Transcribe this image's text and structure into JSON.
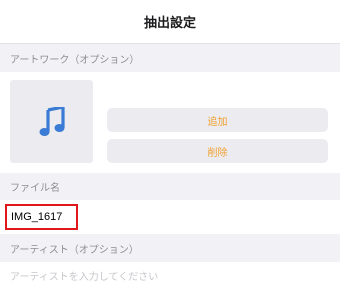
{
  "header": {
    "title": "抽出設定"
  },
  "artwork": {
    "section_label": "アートワーク（オプション）",
    "icon": "music-note-icon",
    "add_label": "追加",
    "delete_label": "削除"
  },
  "filename": {
    "section_label": "ファイル名",
    "value": "IMG_1617"
  },
  "artist": {
    "section_label": "アーティスト（オプション）",
    "placeholder": "アーティストを入力してください"
  },
  "colors": {
    "accent": "#f0a030",
    "music_icon": "#3a7bd5",
    "highlight_border": "#e0181c",
    "section_bg": "#f2f2f6"
  }
}
